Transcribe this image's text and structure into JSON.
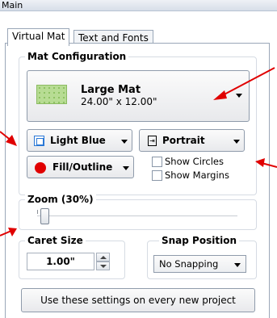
{
  "panel": {
    "title": "Main"
  },
  "tabs": [
    {
      "label": "Virtual Mat",
      "active": true
    },
    {
      "label": "Text and Fonts",
      "active": false
    }
  ],
  "mat_config": {
    "legend": "Mat Configuration",
    "mat_name": "Large Mat",
    "mat_size": "24.00\" x 12.00\"",
    "color_label": "Light Blue",
    "orientation_label": "Portrait",
    "display_label": "Fill/Outline",
    "show_circles": {
      "label": "Show Circles",
      "checked": false
    },
    "show_margins": {
      "label": "Show Margins",
      "checked": false
    }
  },
  "zoom": {
    "legend": "Zoom (30%)",
    "level_percent": 30
  },
  "caret": {
    "legend": "Caret Size",
    "value": "1.00\""
  },
  "snap": {
    "legend": "Snap Position",
    "value": "No Snapping"
  },
  "apply_button": {
    "label": "Use these settings on every new project"
  },
  "colors": {
    "accent_red": "#e00000",
    "swatch_blue": "#2a78d6",
    "dot_red": "#e00000"
  }
}
